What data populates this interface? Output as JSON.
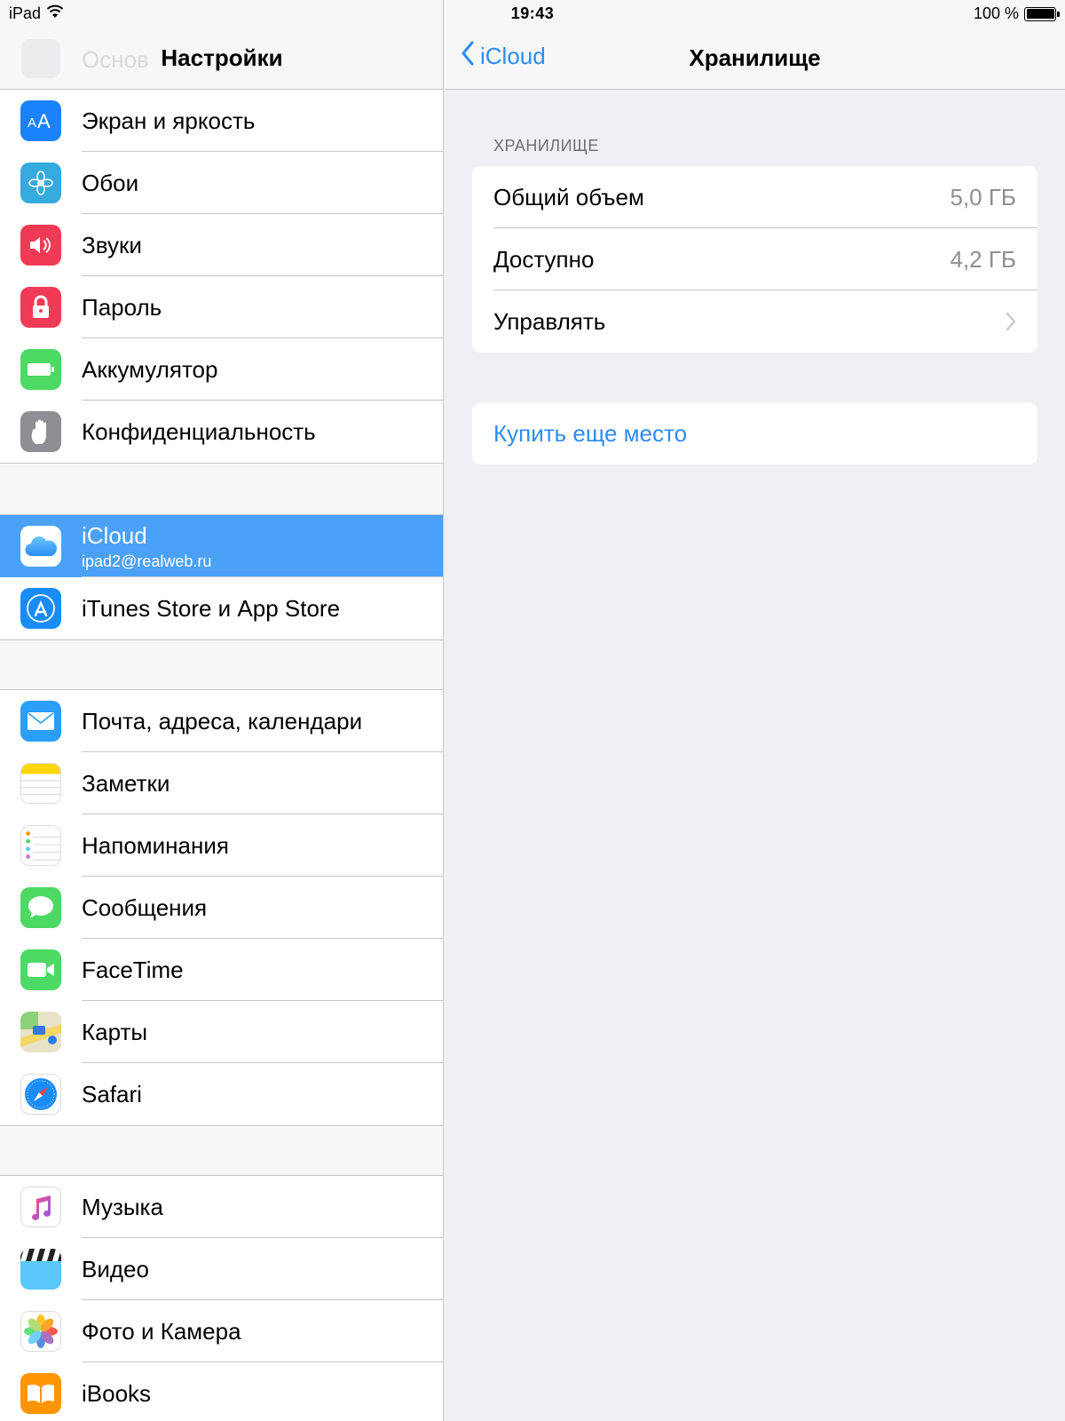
{
  "status_bar": {
    "device": "iPad",
    "time": "19:43",
    "battery_text": "100 %",
    "battery_level": 1.0
  },
  "sidebar": {
    "title": "Настройки",
    "ghost_text": "Основ",
    "groups": [
      {
        "items": [
          {
            "label": "Экран и яркость",
            "icon": "display-brightness-icon",
            "color": "#1a82fb"
          },
          {
            "label": "Обои",
            "icon": "wallpaper-flower-icon",
            "color": "#35aadc"
          },
          {
            "label": "Звуки",
            "icon": "speaker-icon",
            "color": "#f03a56"
          },
          {
            "label": "Пароль",
            "icon": "lock-icon",
            "color": "#f03a56"
          },
          {
            "label": "Аккумулятор",
            "icon": "battery-icon",
            "color": "#4cd964"
          },
          {
            "label": "Конфиденциальность",
            "icon": "hand-icon",
            "color": "#8e8e93"
          }
        ]
      },
      {
        "items": [
          {
            "label": "iCloud",
            "sub": "ipad2@realweb.ru",
            "icon": "icloud-icon",
            "color": "#ffffff",
            "selected": true
          },
          {
            "label": "iTunes Store и App Store",
            "icon": "app-store-icon",
            "color": "#1a8cf9"
          }
        ]
      },
      {
        "items": [
          {
            "label": "Почта, адреса, календари",
            "icon": "mail-icon",
            "color": "#2a9ef8"
          },
          {
            "label": "Заметки",
            "icon": "notes-icon",
            "color": "#ffd60a"
          },
          {
            "label": "Напоминания",
            "icon": "reminders-icon",
            "color": "#ffffff"
          },
          {
            "label": "Сообщения",
            "icon": "messages-icon",
            "color": "#4cd964"
          },
          {
            "label": "FaceTime",
            "icon": "facetime-camera-icon",
            "color": "#4cd964"
          },
          {
            "label": "Карты",
            "icon": "maps-icon",
            "color": "#e8e2c8"
          },
          {
            "label": "Safari",
            "icon": "safari-compass-icon",
            "color": "#ffffff"
          }
        ]
      },
      {
        "items": [
          {
            "label": "Музыка",
            "icon": "music-note-icon",
            "color": "#ffffff"
          },
          {
            "label": "Видео",
            "icon": "video-clapper-icon",
            "color": "#5ac8fa"
          },
          {
            "label": "Фото и Камера",
            "icon": "photos-icon",
            "color": "#ffffff"
          },
          {
            "label": "iBooks",
            "icon": "ibooks-icon",
            "color": "#ff9500"
          }
        ]
      }
    ]
  },
  "detail": {
    "back_label": "iCloud",
    "title": "Хранилище",
    "section_header": "ХРАНИЛИЩЕ",
    "rows": [
      {
        "label": "Общий объем",
        "value": "5,0 ГБ"
      },
      {
        "label": "Доступно",
        "value": "4,2 ГБ"
      },
      {
        "label": "Управлять"
      }
    ],
    "buy_label": "Купить еще место"
  },
  "colors": {
    "accent": "#2c8cf4",
    "selected_row": "#4aa1f7",
    "background": "#efeff4"
  }
}
